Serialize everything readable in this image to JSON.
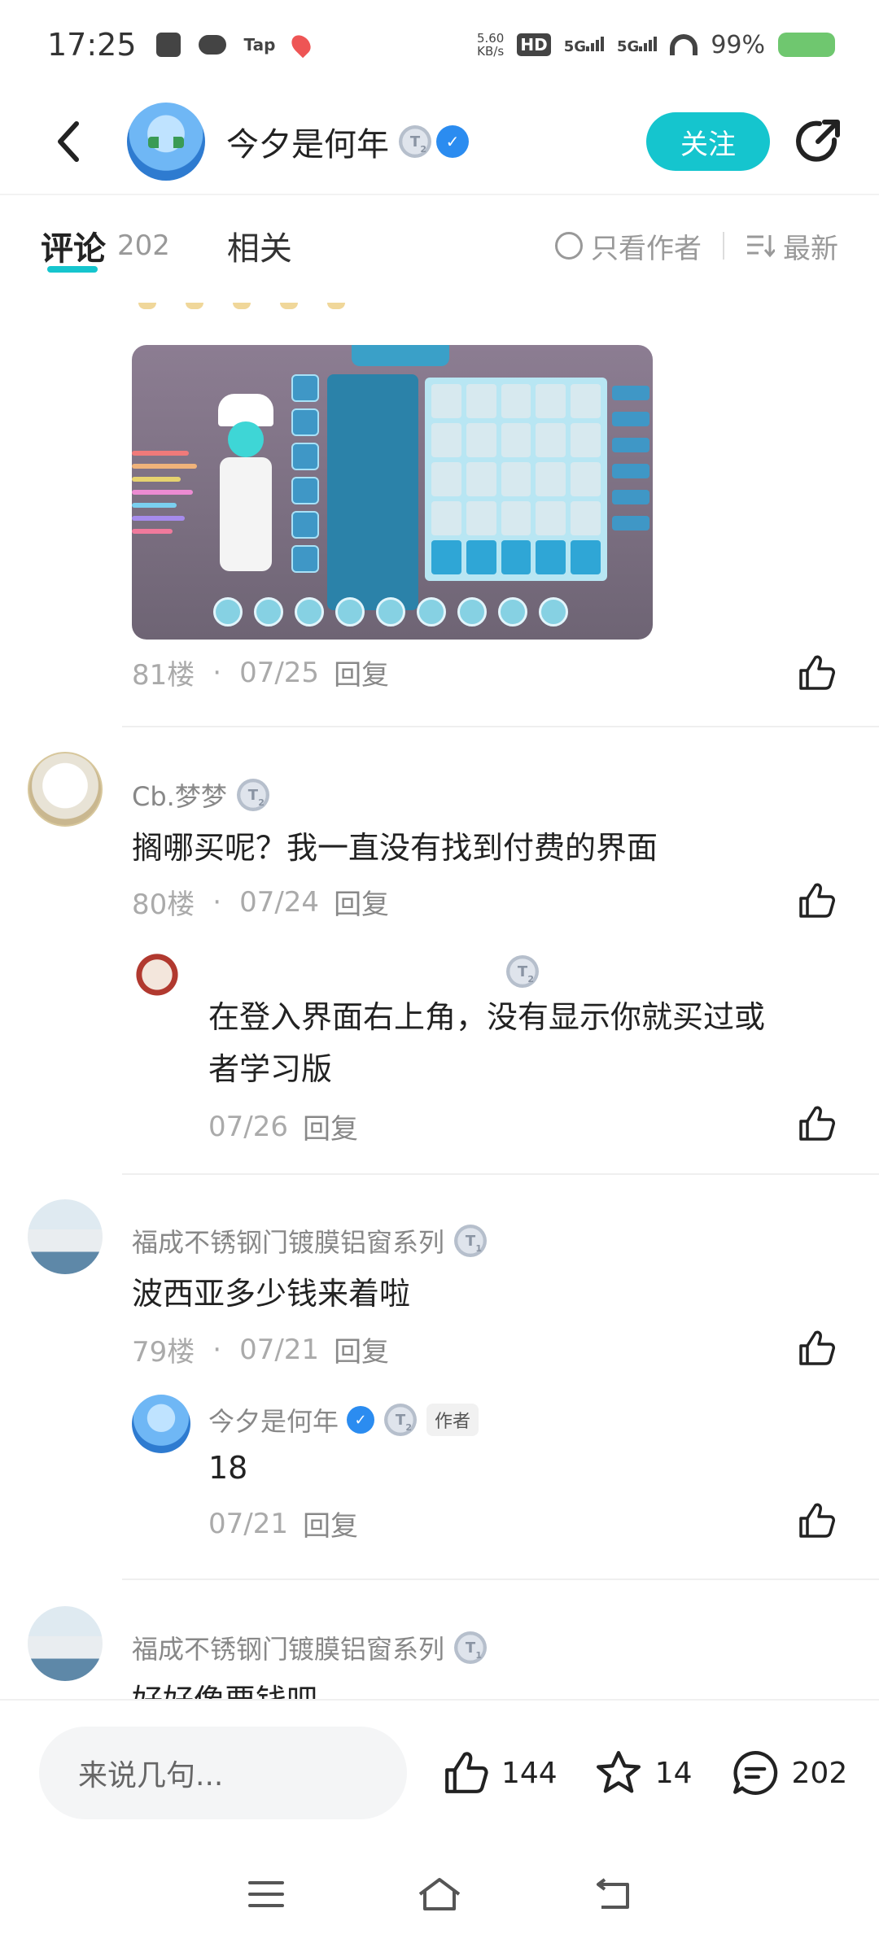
{
  "status_bar": {
    "time": "17:25",
    "speed_value": "5.60",
    "speed_unit": "KB/s",
    "battery": "99%",
    "tap_label": "Tap",
    "hd_label": "HD",
    "net1": "5G",
    "net2": "5G"
  },
  "header": {
    "author_name": "今夕是何年",
    "level": "T",
    "level_num": "2",
    "follow_label": "关注",
    "accent": "#15c5ce"
  },
  "tabs": {
    "comments_label": "评论",
    "comments_count": "202",
    "related_label": "相关",
    "only_author_label": "只看作者",
    "sort_label": "最新"
  },
  "comments": [
    {
      "floor": "81楼",
      "date": "07/25",
      "reply_label": "回复"
    },
    {
      "user": "Cb.梦梦",
      "level": "T",
      "level_num": "2",
      "text": "搁哪买呢？我一直没有找到付费的界面",
      "floor": "80楼",
      "date": "07/24",
      "reply_label": "回复",
      "reply": {
        "level": "T",
        "level_num": "2",
        "text_line1": "在登入界面右上角，没有显示你就买过或",
        "text_line2": "者学习版",
        "date": "07/26",
        "reply_label": "回复"
      }
    },
    {
      "user": "福成不锈钢门镀膜铝窗系列",
      "level": "T",
      "level_num": "1",
      "text": "波西亚多少钱来着啦",
      "floor": "79楼",
      "date": "07/21",
      "reply_label": "回复",
      "reply": {
        "user": "今夕是何年",
        "level": "T",
        "level_num": "2",
        "author_tag": "作者",
        "text": "18",
        "date": "07/21",
        "reply_label": "回复"
      }
    },
    {
      "user": "福成不锈钢门镀膜铝窗系列",
      "level": "T",
      "level_num": "1",
      "text": "好好像要钱吧"
    }
  ],
  "bottom_bar": {
    "input_placeholder": "来说几句...",
    "likes": "144",
    "favorites": "14",
    "comments": "202"
  },
  "icons": {
    "back": "chevron-left-icon",
    "share": "share-icon",
    "like": "thumbs-up-icon",
    "star": "star-icon",
    "comment": "comment-bubble-icon",
    "menu": "menu-icon",
    "home": "home-icon",
    "back_nav": "back-nav-icon"
  }
}
